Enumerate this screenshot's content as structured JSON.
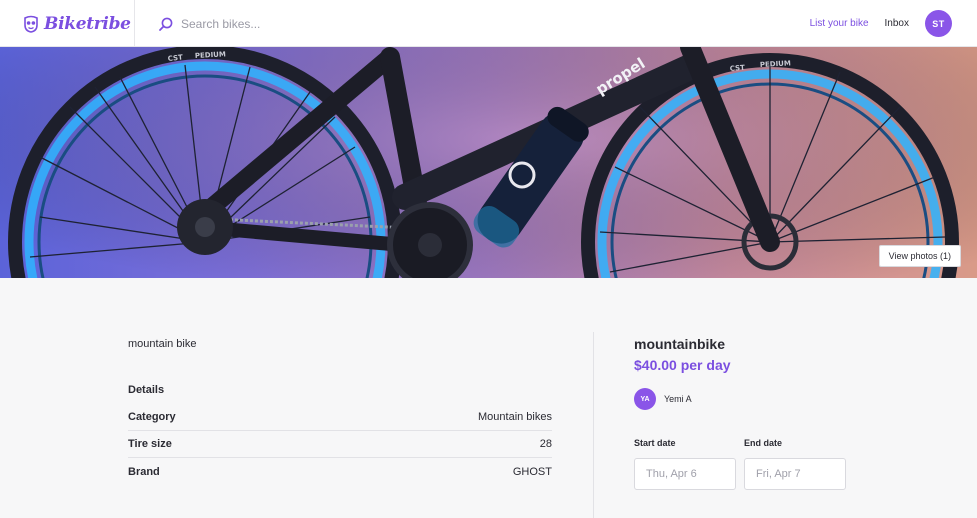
{
  "header": {
    "logo_text": "Biketribe",
    "search_placeholder": "Search bikes...",
    "list_your_bike": "List your bike",
    "inbox": "Inbox",
    "user_initials": "ST"
  },
  "hero": {
    "view_photos_label": "View photos (1)",
    "tire_brand_text": "CST",
    "tire_model_text": "PEDIUM",
    "frame_brand_text": "propel"
  },
  "listing": {
    "description": "mountain bike",
    "details_heading": "Details",
    "details": [
      {
        "label": "Category",
        "value": "Mountain bikes"
      },
      {
        "label": "Tire size",
        "value": "28"
      },
      {
        "label": "Brand",
        "value": "GHOST"
      }
    ],
    "title": "mountainbike",
    "price": "$40.00 per day",
    "owner": {
      "initials": "YA",
      "name": "Yemi A"
    },
    "start_date_label": "Start date",
    "end_date_label": "End date",
    "start_date_placeholder": "Thu, Apr 6",
    "end_date_placeholder": "Fri, Apr 7"
  },
  "colors": {
    "accent": "#7b4fe0",
    "avatar": "#8a55e8",
    "rim_glow": "#2fb4ff"
  },
  "icons": [
    "biketribe-logo-icon",
    "search-icon"
  ]
}
